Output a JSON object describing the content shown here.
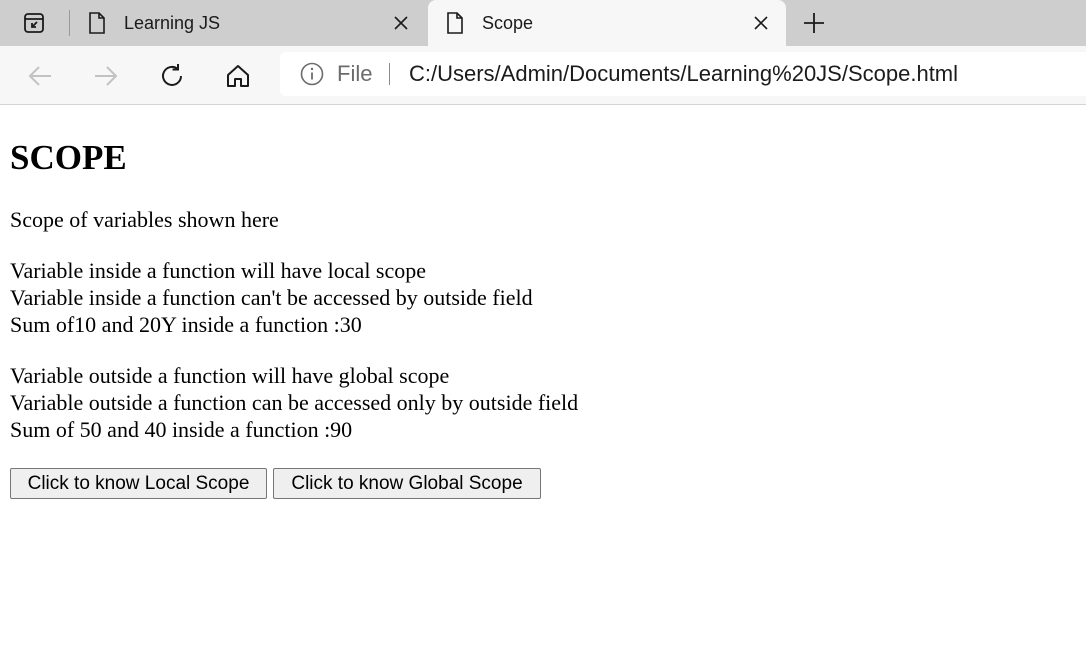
{
  "browser": {
    "tabs": [
      {
        "title": "Learning JS",
        "active": false
      },
      {
        "title": "Scope",
        "active": true
      }
    ],
    "address": {
      "scheme": "File",
      "url": "C:/Users/Admin/Documents/Learning%20JS/Scope.html"
    },
    "icons": {
      "tab_actions": "tab-actions-icon",
      "tab_page": "page-icon",
      "close": "close-icon",
      "new_tab": "plus-icon",
      "back": "back-arrow-icon",
      "forward": "forward-arrow-icon",
      "refresh": "refresh-icon",
      "home": "home-icon",
      "site_info": "info-icon"
    },
    "colors": {
      "tabstrip": "#cecece",
      "toolbar": "#f7f7f7",
      "disabled_icon": "#c2c2c2"
    }
  },
  "page": {
    "heading": "SCOPE",
    "intro": "Scope of variables shown here",
    "local": [
      "Variable inside a function will have local scope",
      "Variable inside a function can't be accessed by outside field",
      "Sum of10 and 20Y inside a function :30"
    ],
    "global": [
      "Variable outside a function will have global scope",
      "Variable outside a function can be accessed only by outside field",
      "Sum of 50 and 40 inside a function :90"
    ],
    "buttons": {
      "local": "Click to know Local Scope",
      "global": "Click to know Global Scope"
    }
  }
}
